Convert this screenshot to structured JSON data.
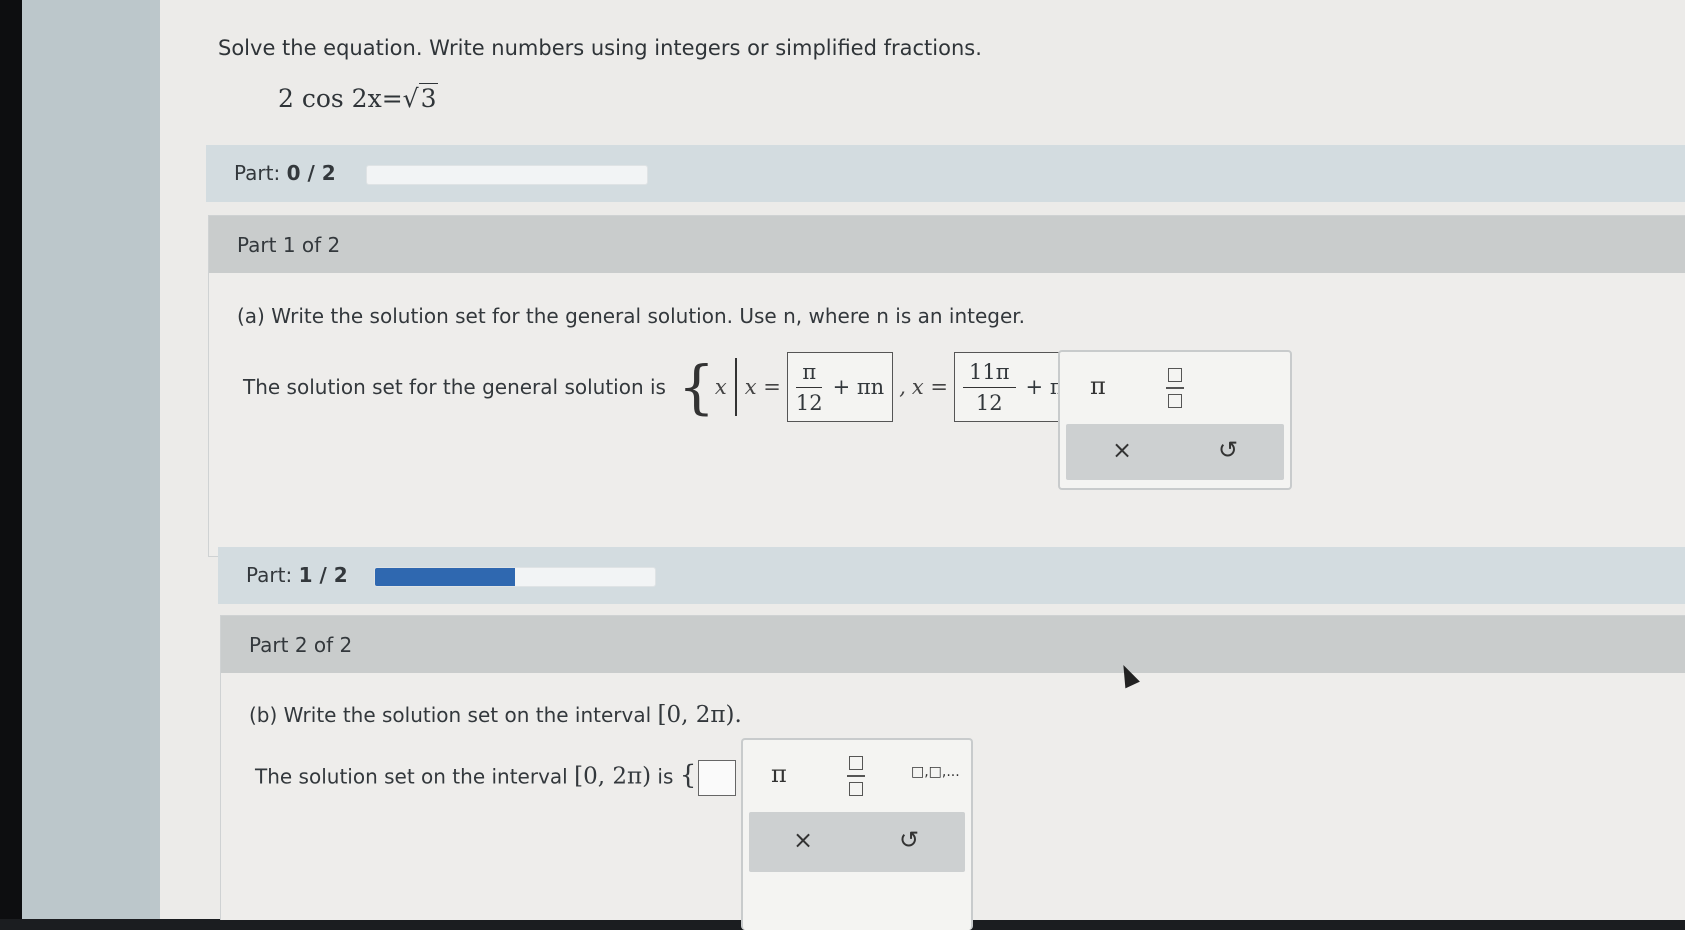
{
  "problem": {
    "instruction": "Solve the equation. Write numbers using integers or simplified fractions.",
    "equation_left": "2 cos 2x",
    "equation_equals": "=",
    "equation_radical": "3"
  },
  "part_progress_1": {
    "label": "Part:",
    "value": "0 / 2",
    "fraction": 0.0
  },
  "part1": {
    "header": "Part 1 of 2",
    "question": "(a) Write the solution set for the general solution. Use n, where n is an integer.",
    "answer_label": "The solution set for the general solution is",
    "set_var": "x",
    "x_eq_1": "x =",
    "answer1": {
      "numerator": "π",
      "denominator": "12",
      "term": "+ πn"
    },
    "separator": ",",
    "x_eq_2": "x =",
    "answer2": {
      "numerator": "11π",
      "denominator": "12",
      "term": "+ πn"
    },
    "trailing": "."
  },
  "palette1": {
    "pi": "π",
    "fraction_icon": "fraction-icon",
    "clear": "×",
    "undo": "↺"
  },
  "part_progress_2": {
    "label": "Part:",
    "value": "1 / 2",
    "fraction": 0.5
  },
  "part2": {
    "header": "Part 2 of 2",
    "question_prefix": "(b) Write the solution set on the interval",
    "interval": "[0, 2π).",
    "answer_prefix": "The solution set on the interval",
    "answer_interval": "[0, 2π)",
    "answer_is": "is",
    "set_open": "{",
    "set_close": "}",
    "trailing": "."
  },
  "palette2": {
    "pi": "π",
    "fraction_icon": "fraction-icon",
    "list_icon": "□,□,...",
    "clear": "×",
    "undo": "↺"
  }
}
